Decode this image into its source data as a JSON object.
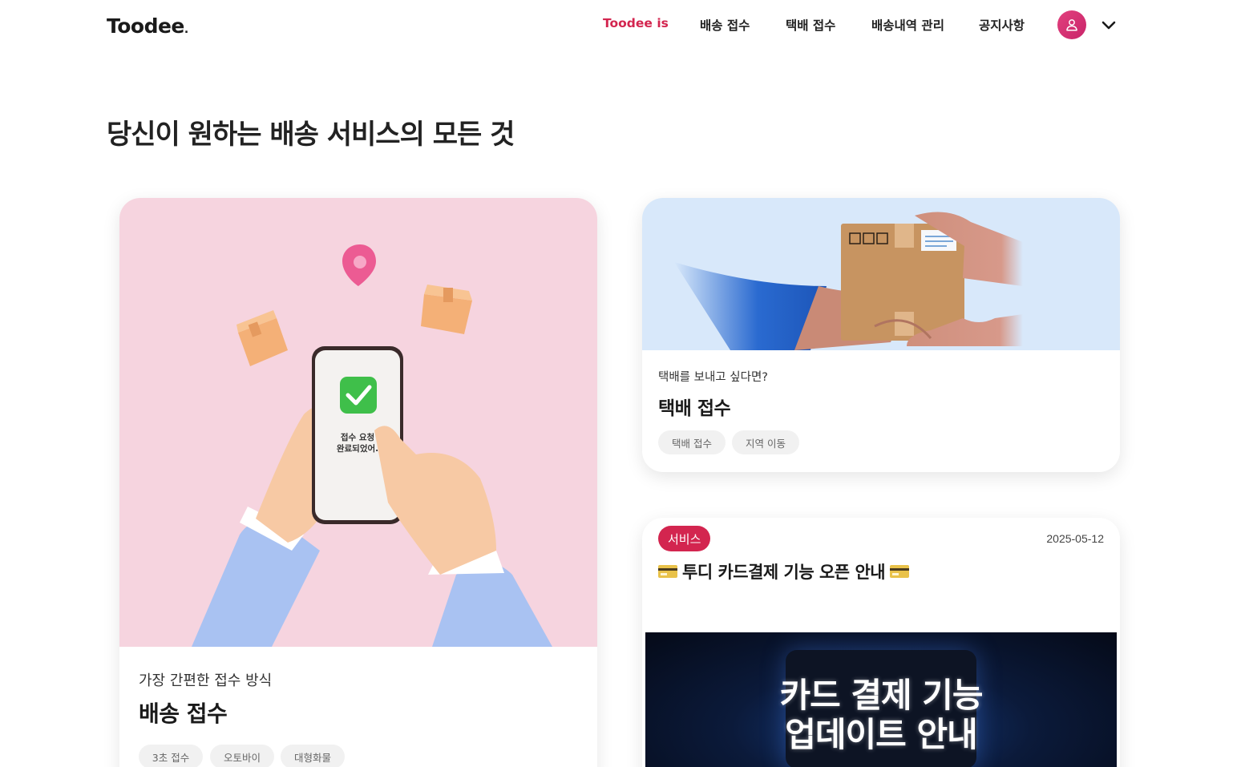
{
  "header": {
    "logo": "Toodee",
    "nav": [
      {
        "label": "Toodee is",
        "active": true
      },
      {
        "label": "배송 접수"
      },
      {
        "label": "택배 접수"
      },
      {
        "label": "배송내역 관리"
      },
      {
        "label": "공지사항"
      }
    ],
    "profile_icon": "user-icon",
    "dropdown_icon": "chevron-down-icon",
    "accent_color": "#d3254f"
  },
  "page_title": "당신이 원하는 배송 서비스의 모든 것",
  "cards": {
    "delivery": {
      "subtitle": "가장 간편한 접수 방식",
      "title": "배송 접수",
      "phone_text_line1": "접수 요청",
      "phone_text_line2": "완료되었어.",
      "tags": [
        "3초 접수",
        "오토바이",
        "대형화물"
      ]
    },
    "parcel": {
      "subtitle": "택배를 보내고 싶다면?",
      "title": "택배 접수",
      "tags": [
        "택배 접수",
        "지역 이동"
      ]
    },
    "notice": {
      "badge": "서비스",
      "date": "2025-05-12",
      "title": "투디 카드결제 기능 오픈 안내",
      "banner_line1": "카드 결제 기능",
      "banner_line2": "업데이트 안내"
    }
  }
}
